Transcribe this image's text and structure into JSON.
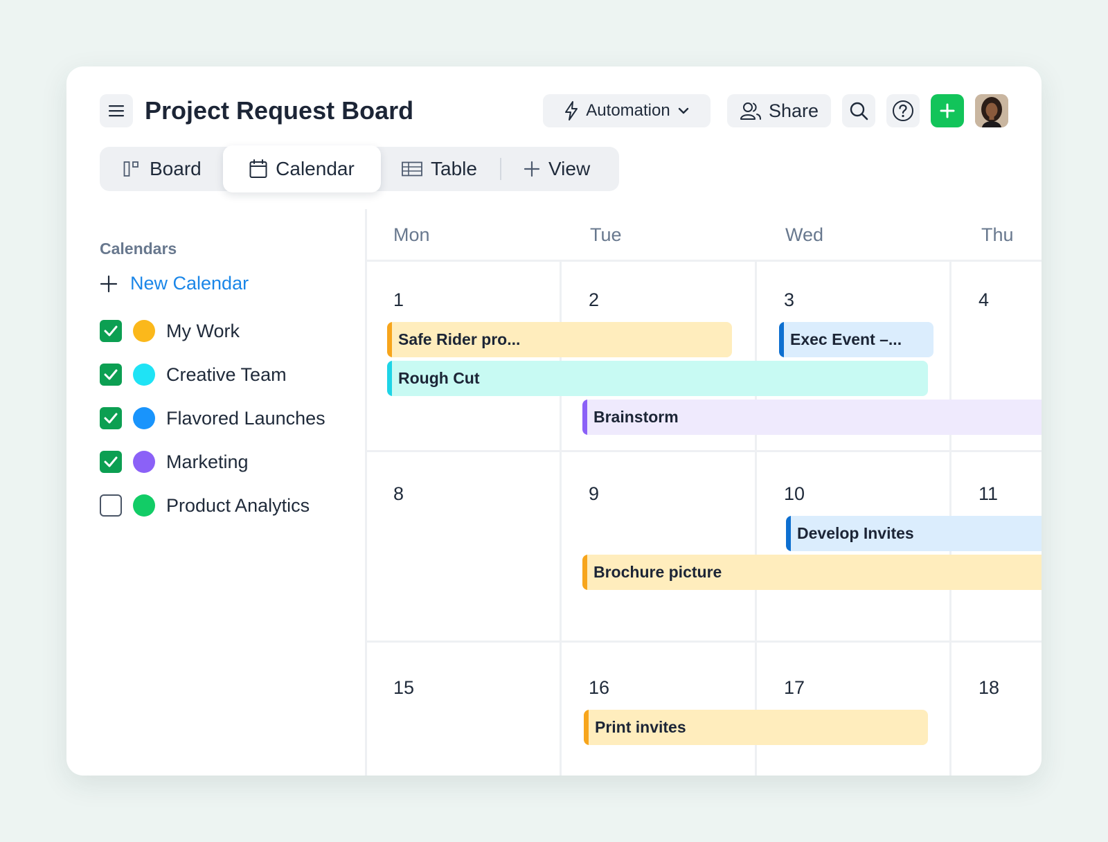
{
  "header": {
    "title": "Project Request Board",
    "automation_label": "Automation",
    "share_label": "Share"
  },
  "tabs": [
    {
      "label": "Board",
      "icon": "board-icon"
    },
    {
      "label": "Calendar",
      "icon": "calendar-icon",
      "active": true
    },
    {
      "label": "Table",
      "icon": "table-icon"
    },
    {
      "label": "View",
      "icon": "plus-icon"
    }
  ],
  "sidebar": {
    "heading": "Calendars",
    "new_calendar_label": "New Calendar",
    "items": [
      {
        "label": "My Work",
        "checked": true,
        "color": "#fbb81b"
      },
      {
        "label": "Creative Team",
        "checked": true,
        "color": "#1fe3f5"
      },
      {
        "label": "Flavored Launches",
        "checked": true,
        "color": "#1994fc"
      },
      {
        "label": "Marketing",
        "checked": true,
        "color": "#8b61f7"
      },
      {
        "label": "Product Analytics",
        "checked": false,
        "color": "#12cc66"
      }
    ]
  },
  "calendar": {
    "days": [
      "Mon",
      "Tue",
      "Wed",
      "Thu"
    ],
    "weeks": [
      [
        "1",
        "2",
        "3",
        "4"
      ],
      [
        "8",
        "9",
        "10",
        "11"
      ],
      [
        "15",
        "16",
        "17",
        "18"
      ]
    ],
    "events": [
      {
        "title": "Safe Rider pro...",
        "color": "yellow"
      },
      {
        "title": "Exec Event –...",
        "color": "blue"
      },
      {
        "title": "Rough Cut",
        "color": "cyan"
      },
      {
        "title": "Brainstorm",
        "color": "purple"
      },
      {
        "title": "Develop Invites",
        "color": "blue"
      },
      {
        "title": "Brochure picture",
        "color": "yellow"
      },
      {
        "title": "Print invites",
        "color": "yellow"
      }
    ]
  },
  "colors": {
    "accent_green": "#12c45a",
    "link_blue": "#1a86e8",
    "event_yellow_bg": "#ffedbd",
    "event_yellow_stripe": "#f7a51c",
    "event_blue_bg": "#dbedfd",
    "event_blue_stripe": "#0d6fd0",
    "event_cyan_bg": "#c8faf3",
    "event_cyan_stripe": "#1ed4e6",
    "event_purple_bg": "#efeafd",
    "event_purple_stripe": "#8b61f7"
  }
}
